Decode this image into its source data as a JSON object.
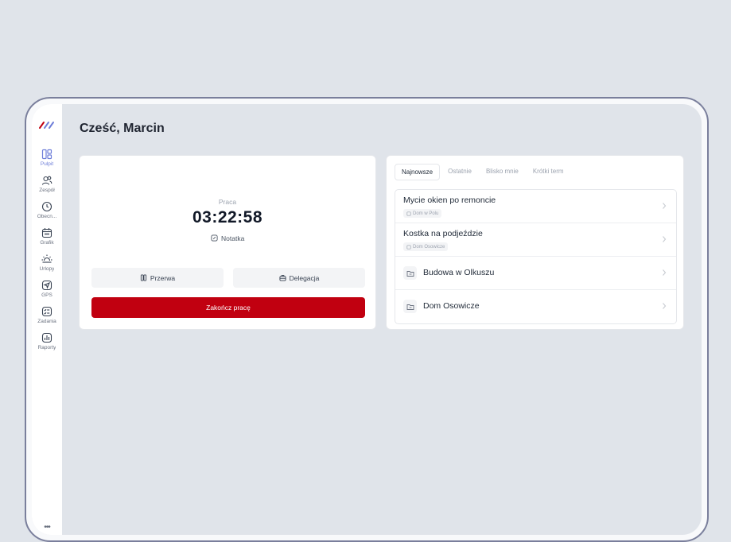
{
  "header": {
    "greeting": "Cześć, Marcin"
  },
  "sidebar": {
    "items": [
      {
        "label": "Pulpit",
        "icon": "dashboard-icon",
        "active": true
      },
      {
        "label": "Zespół",
        "icon": "team-icon"
      },
      {
        "label": "Obecn...",
        "icon": "clock-icon"
      },
      {
        "label": "Grafik",
        "icon": "calendar-icon"
      },
      {
        "label": "Urlopy",
        "icon": "sun-icon"
      },
      {
        "label": "GPS",
        "icon": "gps-icon"
      },
      {
        "label": "Zadania",
        "icon": "tasks-icon"
      },
      {
        "label": "Raporty",
        "icon": "reports-icon"
      }
    ],
    "more": "•••"
  },
  "timer": {
    "status": "Praca",
    "time": "03:22:58",
    "note": "Notatka",
    "break_label": "Przerwa",
    "delegation_label": "Delegacja",
    "end_label": "Zakończ pracę"
  },
  "tasks": {
    "tabs": [
      {
        "label": "Najnowsze",
        "active": true
      },
      {
        "label": "Ostatnie"
      },
      {
        "label": "Blisko mnie"
      },
      {
        "label": "Krótki term"
      }
    ],
    "items": [
      {
        "title": "Mycie okien po remoncie",
        "tag": "Dom w Polu"
      },
      {
        "title": "Kostka na podjeździe",
        "tag": "Dom Osowicze"
      },
      {
        "title": "Budowa w Olkuszu"
      },
      {
        "title": "Dom Osowicze"
      }
    ]
  },
  "colors": {
    "accent": "#6f7fd9",
    "danger": "#c10010",
    "background": "#e0e4ea"
  }
}
